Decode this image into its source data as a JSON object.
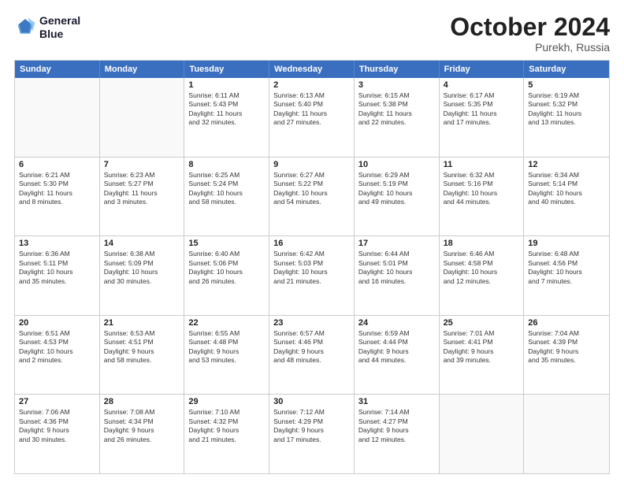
{
  "header": {
    "logo_line1": "General",
    "logo_line2": "Blue",
    "month": "October 2024",
    "location": "Purekh, Russia"
  },
  "weekdays": [
    "Sunday",
    "Monday",
    "Tuesday",
    "Wednesday",
    "Thursday",
    "Friday",
    "Saturday"
  ],
  "rows": [
    [
      {
        "day": "",
        "text": ""
      },
      {
        "day": "",
        "text": ""
      },
      {
        "day": "1",
        "text": "Sunrise: 6:11 AM\nSunset: 5:43 PM\nDaylight: 11 hours\nand 32 minutes."
      },
      {
        "day": "2",
        "text": "Sunrise: 6:13 AM\nSunset: 5:40 PM\nDaylight: 11 hours\nand 27 minutes."
      },
      {
        "day": "3",
        "text": "Sunrise: 6:15 AM\nSunset: 5:38 PM\nDaylight: 11 hours\nand 22 minutes."
      },
      {
        "day": "4",
        "text": "Sunrise: 6:17 AM\nSunset: 5:35 PM\nDaylight: 11 hours\nand 17 minutes."
      },
      {
        "day": "5",
        "text": "Sunrise: 6:19 AM\nSunset: 5:32 PM\nDaylight: 11 hours\nand 13 minutes."
      }
    ],
    [
      {
        "day": "6",
        "text": "Sunrise: 6:21 AM\nSunset: 5:30 PM\nDaylight: 11 hours\nand 8 minutes."
      },
      {
        "day": "7",
        "text": "Sunrise: 6:23 AM\nSunset: 5:27 PM\nDaylight: 11 hours\nand 3 minutes."
      },
      {
        "day": "8",
        "text": "Sunrise: 6:25 AM\nSunset: 5:24 PM\nDaylight: 10 hours\nand 58 minutes."
      },
      {
        "day": "9",
        "text": "Sunrise: 6:27 AM\nSunset: 5:22 PM\nDaylight: 10 hours\nand 54 minutes."
      },
      {
        "day": "10",
        "text": "Sunrise: 6:29 AM\nSunset: 5:19 PM\nDaylight: 10 hours\nand 49 minutes."
      },
      {
        "day": "11",
        "text": "Sunrise: 6:32 AM\nSunset: 5:16 PM\nDaylight: 10 hours\nand 44 minutes."
      },
      {
        "day": "12",
        "text": "Sunrise: 6:34 AM\nSunset: 5:14 PM\nDaylight: 10 hours\nand 40 minutes."
      }
    ],
    [
      {
        "day": "13",
        "text": "Sunrise: 6:36 AM\nSunset: 5:11 PM\nDaylight: 10 hours\nand 35 minutes."
      },
      {
        "day": "14",
        "text": "Sunrise: 6:38 AM\nSunset: 5:09 PM\nDaylight: 10 hours\nand 30 minutes."
      },
      {
        "day": "15",
        "text": "Sunrise: 6:40 AM\nSunset: 5:06 PM\nDaylight: 10 hours\nand 26 minutes."
      },
      {
        "day": "16",
        "text": "Sunrise: 6:42 AM\nSunset: 5:03 PM\nDaylight: 10 hours\nand 21 minutes."
      },
      {
        "day": "17",
        "text": "Sunrise: 6:44 AM\nSunset: 5:01 PM\nDaylight: 10 hours\nand 16 minutes."
      },
      {
        "day": "18",
        "text": "Sunrise: 6:46 AM\nSunset: 4:58 PM\nDaylight: 10 hours\nand 12 minutes."
      },
      {
        "day": "19",
        "text": "Sunrise: 6:48 AM\nSunset: 4:56 PM\nDaylight: 10 hours\nand 7 minutes."
      }
    ],
    [
      {
        "day": "20",
        "text": "Sunrise: 6:51 AM\nSunset: 4:53 PM\nDaylight: 10 hours\nand 2 minutes."
      },
      {
        "day": "21",
        "text": "Sunrise: 6:53 AM\nSunset: 4:51 PM\nDaylight: 9 hours\nand 58 minutes."
      },
      {
        "day": "22",
        "text": "Sunrise: 6:55 AM\nSunset: 4:48 PM\nDaylight: 9 hours\nand 53 minutes."
      },
      {
        "day": "23",
        "text": "Sunrise: 6:57 AM\nSunset: 4:46 PM\nDaylight: 9 hours\nand 48 minutes."
      },
      {
        "day": "24",
        "text": "Sunrise: 6:59 AM\nSunset: 4:44 PM\nDaylight: 9 hours\nand 44 minutes."
      },
      {
        "day": "25",
        "text": "Sunrise: 7:01 AM\nSunset: 4:41 PM\nDaylight: 9 hours\nand 39 minutes."
      },
      {
        "day": "26",
        "text": "Sunrise: 7:04 AM\nSunset: 4:39 PM\nDaylight: 9 hours\nand 35 minutes."
      }
    ],
    [
      {
        "day": "27",
        "text": "Sunrise: 7:06 AM\nSunset: 4:36 PM\nDaylight: 9 hours\nand 30 minutes."
      },
      {
        "day": "28",
        "text": "Sunrise: 7:08 AM\nSunset: 4:34 PM\nDaylight: 9 hours\nand 26 minutes."
      },
      {
        "day": "29",
        "text": "Sunrise: 7:10 AM\nSunset: 4:32 PM\nDaylight: 9 hours\nand 21 minutes."
      },
      {
        "day": "30",
        "text": "Sunrise: 7:12 AM\nSunset: 4:29 PM\nDaylight: 9 hours\nand 17 minutes."
      },
      {
        "day": "31",
        "text": "Sunrise: 7:14 AM\nSunset: 4:27 PM\nDaylight: 9 hours\nand 12 minutes."
      },
      {
        "day": "",
        "text": ""
      },
      {
        "day": "",
        "text": ""
      }
    ]
  ]
}
